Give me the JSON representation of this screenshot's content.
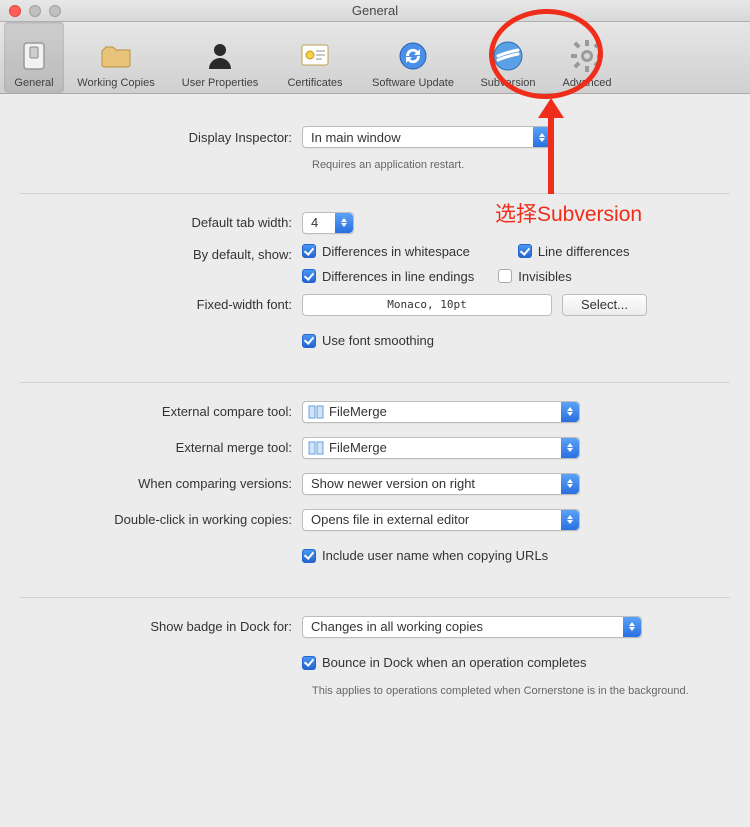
{
  "window": {
    "title": "General"
  },
  "toolbar": {
    "items": [
      {
        "label": "General",
        "active": true
      },
      {
        "label": "Working Copies",
        "active": false
      },
      {
        "label": "User Properties",
        "active": false
      },
      {
        "label": "Certificates",
        "active": false
      },
      {
        "label": "Software Update",
        "active": false
      },
      {
        "label": "Subversion",
        "active": false
      },
      {
        "label": "Advanced",
        "active": false
      }
    ]
  },
  "section1": {
    "displayInspectorLabel": "Display Inspector:",
    "displayInspectorValue": "In main window",
    "restartNote": "Requires an application restart."
  },
  "section2": {
    "tabWidthLabel": "Default tab width:",
    "tabWidthValue": "4",
    "byDefaultShowLabel": "By default, show:",
    "diffWhitespace": "Differences in whitespace",
    "lineDifferences": "Line differences",
    "diffLineEndings": "Differences in line endings",
    "invisibles": "Invisibles",
    "fixedFontLabel": "Fixed-width font:",
    "fixedFontValue": "Monaco, 10pt",
    "selectBtn": "Select...",
    "useFontSmoothing": "Use font smoothing"
  },
  "section3": {
    "compareToolLabel": "External compare tool:",
    "compareToolValue": "FileMerge",
    "mergeToolLabel": "External merge tool:",
    "mergeToolValue": "FileMerge",
    "compareVersionsLabel": "When comparing versions:",
    "compareVersionsValue": "Show newer version on right",
    "doubleClickLabel": "Double-click in working copies:",
    "doubleClickValue": "Opens file in external editor",
    "includeUserName": "Include user name when copying URLs"
  },
  "section4": {
    "dockBadgeLabel": "Show badge in Dock for:",
    "dockBadgeValue": "Changes in all working copies",
    "bounceDock": "Bounce in Dock when an operation completes",
    "bounceNote": "This applies to operations completed when Cornerstone is in the background."
  },
  "annotation": {
    "text": "选择Subversion"
  }
}
